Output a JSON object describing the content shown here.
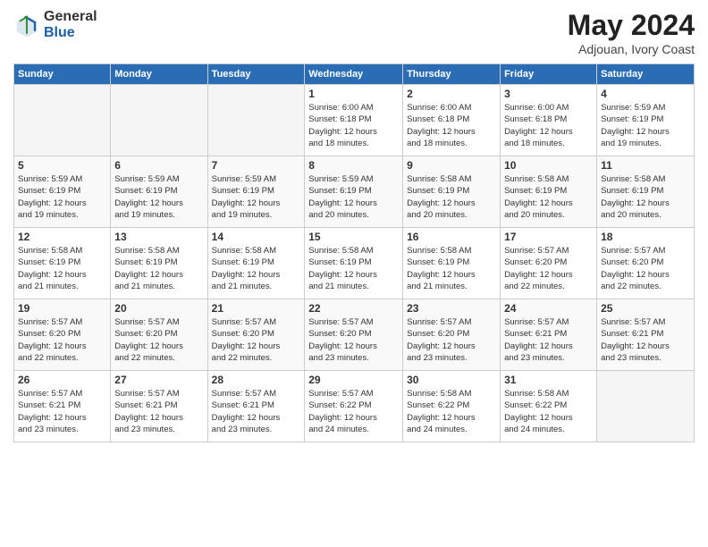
{
  "logo": {
    "general": "General",
    "blue": "Blue"
  },
  "header": {
    "month": "May 2024",
    "location": "Adjouan, Ivory Coast"
  },
  "weekdays": [
    "Sunday",
    "Monday",
    "Tuesday",
    "Wednesday",
    "Thursday",
    "Friday",
    "Saturday"
  ],
  "weeks": [
    [
      {
        "day": "",
        "info": ""
      },
      {
        "day": "",
        "info": ""
      },
      {
        "day": "",
        "info": ""
      },
      {
        "day": "1",
        "info": "Sunrise: 6:00 AM\nSunset: 6:18 PM\nDaylight: 12 hours\nand 18 minutes."
      },
      {
        "day": "2",
        "info": "Sunrise: 6:00 AM\nSunset: 6:18 PM\nDaylight: 12 hours\nand 18 minutes."
      },
      {
        "day": "3",
        "info": "Sunrise: 6:00 AM\nSunset: 6:18 PM\nDaylight: 12 hours\nand 18 minutes."
      },
      {
        "day": "4",
        "info": "Sunrise: 5:59 AM\nSunset: 6:19 PM\nDaylight: 12 hours\nand 19 minutes."
      }
    ],
    [
      {
        "day": "5",
        "info": "Sunrise: 5:59 AM\nSunset: 6:19 PM\nDaylight: 12 hours\nand 19 minutes."
      },
      {
        "day": "6",
        "info": "Sunrise: 5:59 AM\nSunset: 6:19 PM\nDaylight: 12 hours\nand 19 minutes."
      },
      {
        "day": "7",
        "info": "Sunrise: 5:59 AM\nSunset: 6:19 PM\nDaylight: 12 hours\nand 19 minutes."
      },
      {
        "day": "8",
        "info": "Sunrise: 5:59 AM\nSunset: 6:19 PM\nDaylight: 12 hours\nand 20 minutes."
      },
      {
        "day": "9",
        "info": "Sunrise: 5:58 AM\nSunset: 6:19 PM\nDaylight: 12 hours\nand 20 minutes."
      },
      {
        "day": "10",
        "info": "Sunrise: 5:58 AM\nSunset: 6:19 PM\nDaylight: 12 hours\nand 20 minutes."
      },
      {
        "day": "11",
        "info": "Sunrise: 5:58 AM\nSunset: 6:19 PM\nDaylight: 12 hours\nand 20 minutes."
      }
    ],
    [
      {
        "day": "12",
        "info": "Sunrise: 5:58 AM\nSunset: 6:19 PM\nDaylight: 12 hours\nand 21 minutes."
      },
      {
        "day": "13",
        "info": "Sunrise: 5:58 AM\nSunset: 6:19 PM\nDaylight: 12 hours\nand 21 minutes."
      },
      {
        "day": "14",
        "info": "Sunrise: 5:58 AM\nSunset: 6:19 PM\nDaylight: 12 hours\nand 21 minutes."
      },
      {
        "day": "15",
        "info": "Sunrise: 5:58 AM\nSunset: 6:19 PM\nDaylight: 12 hours\nand 21 minutes."
      },
      {
        "day": "16",
        "info": "Sunrise: 5:58 AM\nSunset: 6:19 PM\nDaylight: 12 hours\nand 21 minutes."
      },
      {
        "day": "17",
        "info": "Sunrise: 5:57 AM\nSunset: 6:20 PM\nDaylight: 12 hours\nand 22 minutes."
      },
      {
        "day": "18",
        "info": "Sunrise: 5:57 AM\nSunset: 6:20 PM\nDaylight: 12 hours\nand 22 minutes."
      }
    ],
    [
      {
        "day": "19",
        "info": "Sunrise: 5:57 AM\nSunset: 6:20 PM\nDaylight: 12 hours\nand 22 minutes."
      },
      {
        "day": "20",
        "info": "Sunrise: 5:57 AM\nSunset: 6:20 PM\nDaylight: 12 hours\nand 22 minutes."
      },
      {
        "day": "21",
        "info": "Sunrise: 5:57 AM\nSunset: 6:20 PM\nDaylight: 12 hours\nand 22 minutes."
      },
      {
        "day": "22",
        "info": "Sunrise: 5:57 AM\nSunset: 6:20 PM\nDaylight: 12 hours\nand 23 minutes."
      },
      {
        "day": "23",
        "info": "Sunrise: 5:57 AM\nSunset: 6:20 PM\nDaylight: 12 hours\nand 23 minutes."
      },
      {
        "day": "24",
        "info": "Sunrise: 5:57 AM\nSunset: 6:21 PM\nDaylight: 12 hours\nand 23 minutes."
      },
      {
        "day": "25",
        "info": "Sunrise: 5:57 AM\nSunset: 6:21 PM\nDaylight: 12 hours\nand 23 minutes."
      }
    ],
    [
      {
        "day": "26",
        "info": "Sunrise: 5:57 AM\nSunset: 6:21 PM\nDaylight: 12 hours\nand 23 minutes."
      },
      {
        "day": "27",
        "info": "Sunrise: 5:57 AM\nSunset: 6:21 PM\nDaylight: 12 hours\nand 23 minutes."
      },
      {
        "day": "28",
        "info": "Sunrise: 5:57 AM\nSunset: 6:21 PM\nDaylight: 12 hours\nand 23 minutes."
      },
      {
        "day": "29",
        "info": "Sunrise: 5:57 AM\nSunset: 6:22 PM\nDaylight: 12 hours\nand 24 minutes."
      },
      {
        "day": "30",
        "info": "Sunrise: 5:58 AM\nSunset: 6:22 PM\nDaylight: 12 hours\nand 24 minutes."
      },
      {
        "day": "31",
        "info": "Sunrise: 5:58 AM\nSunset: 6:22 PM\nDaylight: 12 hours\nand 24 minutes."
      },
      {
        "day": "",
        "info": ""
      }
    ]
  ]
}
